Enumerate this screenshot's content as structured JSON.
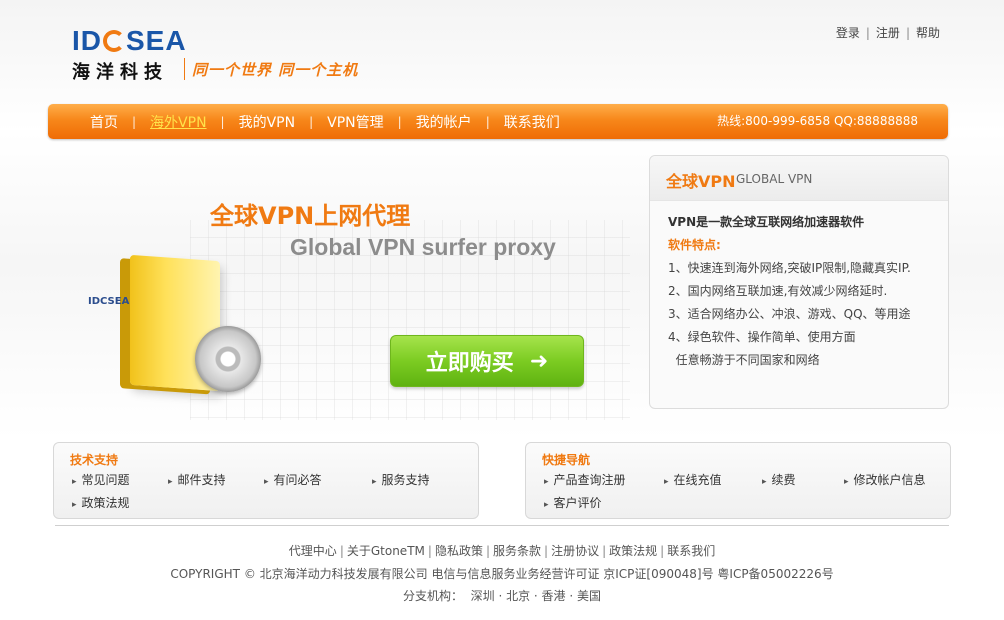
{
  "brand": {
    "logo_text_1": "ID",
    "logo_text_2": "SEA",
    "cn_name": "海洋科技",
    "slogan": "同一个世界  同一个主机",
    "colors": {
      "primary_orange": "#f07a12",
      "logo_blue": "#1a56a8",
      "buy_green": "#7ccc22"
    }
  },
  "top_links": [
    {
      "label": "登录"
    },
    {
      "label": "注册"
    },
    {
      "label": "帮助"
    }
  ],
  "nav": {
    "items": [
      {
        "label": "首页"
      },
      {
        "label": "海外VPN",
        "active": true
      },
      {
        "label": "我的VPN"
      },
      {
        "label": "VPN管理"
      },
      {
        "label": "我的帐户"
      },
      {
        "label": "联系我们"
      }
    ],
    "separator": "|",
    "hotline": "热线:800-999-6858  QQ:88888888"
  },
  "banner": {
    "title": "全球VPN上网代理",
    "subtitle": "Global VPN surfer proxy",
    "product_label": "IDCSEA",
    "buy_button": "立即购买",
    "buy_arrow": "➜"
  },
  "panel": {
    "title": "全球VPN",
    "title_en": "GLOBAL VPN",
    "intro": "VPN是一款全球互联网络加速器软件",
    "features_label": "软件特点:",
    "features": [
      "1、快速连到海外网络,突破IP限制,隐藏真实IP.",
      "2、国内网络互联加速,有效减少网络延时.",
      "3、适合网络办公、冲浪、游戏、QQ、等用途",
      "4、绿色软件、操作简单、使用方面",
      "  任意畅游于不同国家和网络"
    ]
  },
  "support": {
    "title": "技术支持",
    "links": [
      "常见问题",
      "邮件支持",
      "有问必答",
      "服务支持",
      "政策法规"
    ]
  },
  "quick": {
    "title": "快捷导航",
    "links": [
      "产品查询注册",
      "在线充值",
      "续费",
      "修改帐户信息",
      "客户评价"
    ]
  },
  "footer": {
    "links": [
      "代理中心",
      "关于GtoneTM",
      "隐私政策",
      "服务条款",
      "注册协议",
      "政策法规",
      "联系我们"
    ],
    "copyright": "COPYRIGHT © 北京海洋动力科技发展有限公司 电信与信息服务业务经营许可证 京ICP证[090048]号 粤ICP备05002226号",
    "branches": "分支机构：  深圳 · 北京 · 香港 · 美国"
  }
}
